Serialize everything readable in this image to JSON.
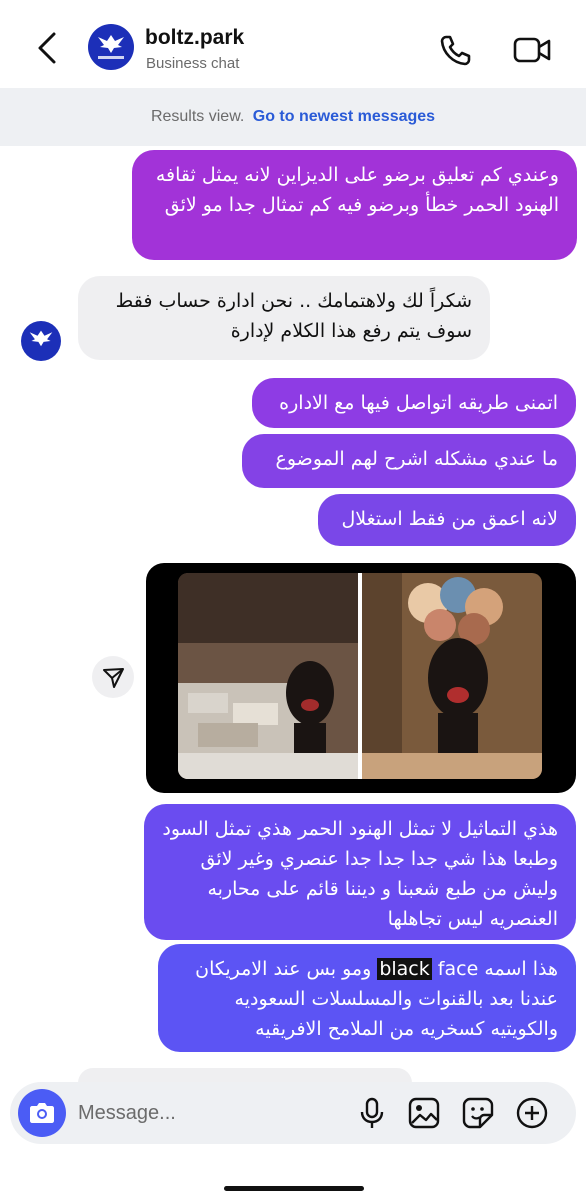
{
  "header": {
    "name": "boltz.park",
    "subtitle": "Business chat",
    "logo_text": "BOLTZ PARK"
  },
  "banner": {
    "text": "Results view.",
    "link": "Go to newest messages"
  },
  "messages": [
    {
      "direction": "outgoing",
      "text": "وعندي كم تعليق برضو على الديزاين لانه يمثل ثقافه الهنود الحمر خطأ وبرضو فيه كم تمثال جدا مو لائق"
    },
    {
      "direction": "incoming",
      "text": "شكراً لك ولاهتمامك .. نحن ادارة حساب فقط سوف يتم رفع هذا الكلام لإدارة"
    },
    {
      "direction": "outgoing",
      "text": "اتمنى طريقه اتواصل فيها مع الاداره"
    },
    {
      "direction": "outgoing",
      "text": "ما عندي مشكله اشرح لهم الموضوع"
    },
    {
      "direction": "outgoing",
      "text": "لانه اعمق من فقط استغلال"
    },
    {
      "direction": "outgoing",
      "text": "هذي التماثيل لا تمثل الهنود الحمر هذي تمثل السود وطبعا هذا شي جدا جدا جدا عنصري وغير لائق وليش من طبع شعبنا و ديننا قائم على محاربه العنصريه ليس تجاهلها"
    },
    {
      "direction": "outgoing",
      "prefix": "هذا اسمه",
      "highlight": "black",
      "face": "face",
      "rest": "ومو بس عند الامريكان عندنا بعد بالقنوات والمسلسلات السعوديه والكويتيه كسخريه من الملامح الافريقيه"
    }
  ],
  "composer": {
    "placeholder": "Message..."
  },
  "icons": {
    "back": "chevron-left-icon",
    "call": "phone-icon",
    "video": "video-camera-icon",
    "share": "send-icon",
    "camera": "camera-icon",
    "mic": "microphone-icon",
    "gallery": "image-icon",
    "sticker": "sticker-icon",
    "plus": "plus-circle-icon"
  },
  "colors": {
    "incoming_bubble": "#efeff1",
    "gradient_top": "#a233d8",
    "gradient_bottom": "#5c54f4",
    "link": "#2a5bd7",
    "camera_button": "#4b5cf5"
  }
}
